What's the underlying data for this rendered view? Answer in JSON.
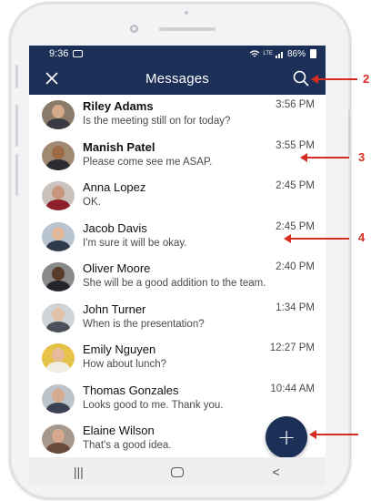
{
  "status_bar": {
    "time": "9:36",
    "battery": "86%",
    "network": "LTE"
  },
  "app_bar": {
    "title": "Messages",
    "close_icon": "close-icon",
    "search_icon": "search-icon"
  },
  "colors": {
    "primary": "#1c3057",
    "annotation": "#d62b20"
  },
  "conversations": [
    {
      "name": "Riley Adams",
      "time": "3:56 PM",
      "preview": "Is the meeting still on for today?",
      "unread": true
    },
    {
      "name": "Manish Patel",
      "time": "3:55 PM",
      "preview": "Please come see me ASAP.",
      "unread": true
    },
    {
      "name": "Anna Lopez",
      "time": "2:45 PM",
      "preview": "OK.",
      "unread": false
    },
    {
      "name": "Jacob Davis",
      "time": "2:45 PM",
      "preview": "I'm sure it will be okay.",
      "unread": false
    },
    {
      "name": "Oliver Moore",
      "time": "2:40 PM",
      "preview": "She will be a good addition to the team.",
      "unread": false
    },
    {
      "name": "John Turner",
      "time": "1:34 PM",
      "preview": "When is the presentation?",
      "unread": false
    },
    {
      "name": "Emily Nguyen",
      "time": "12:27 PM",
      "preview": "How about lunch?",
      "unread": false
    },
    {
      "name": "Thomas Gonzales",
      "time": "10:44 AM",
      "preview": "Looks good to me. Thank you.",
      "unread": false
    },
    {
      "name": "Elaine Wilson",
      "time": "",
      "preview": "That's a good idea.",
      "unread": false
    }
  ],
  "fab": {
    "label": "+"
  },
  "nav_bar": {
    "recents": "|||",
    "back": "<"
  },
  "annotations": [
    "2",
    "3",
    "4"
  ]
}
